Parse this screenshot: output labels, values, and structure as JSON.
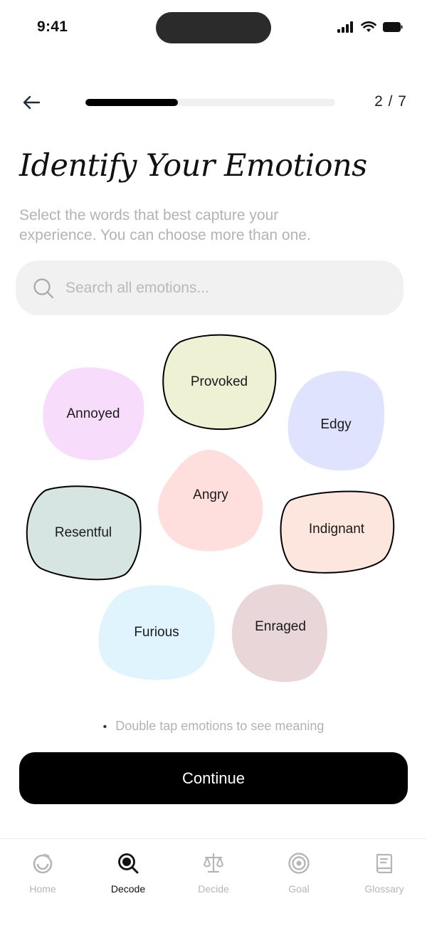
{
  "status": {
    "time": "9:41"
  },
  "header": {
    "step": "2 / 7",
    "progress": 0.37
  },
  "title": "Identify Your Emotions",
  "subtitle": "Select the words that best capture your experience. You can choose more than one.",
  "search": {
    "placeholder": "Search all emotions...",
    "value": ""
  },
  "emotions": [
    {
      "label": "Annoyed",
      "color": "#f8dcfb",
      "selected": false
    },
    {
      "label": "Provoked",
      "color": "#eff1d4",
      "selected": true
    },
    {
      "label": "Edgy",
      "color": "#dfe3fe",
      "selected": false
    },
    {
      "label": "Angry",
      "color": "#ffdede",
      "selected": false
    },
    {
      "label": "Resentful",
      "color": "#d6e5e1",
      "selected": true
    },
    {
      "label": "Indignant",
      "color": "#fde6de",
      "selected": true
    },
    {
      "label": "Furious",
      "color": "#dff4fc",
      "selected": false
    },
    {
      "label": "Enraged",
      "color": "#e8d6d9",
      "selected": false
    }
  ],
  "hint": "Double tap emotions to see meaning",
  "continue_label": "Continue",
  "tabs": [
    {
      "label": "Home",
      "icon": "home-icon",
      "active": false
    },
    {
      "label": "Decode",
      "icon": "decode-search-icon",
      "active": true
    },
    {
      "label": "Decide",
      "icon": "scales-icon",
      "active": false
    },
    {
      "label": "Goal",
      "icon": "target-icon",
      "active": false
    },
    {
      "label": "Glossary",
      "icon": "book-icon",
      "active": false
    }
  ]
}
